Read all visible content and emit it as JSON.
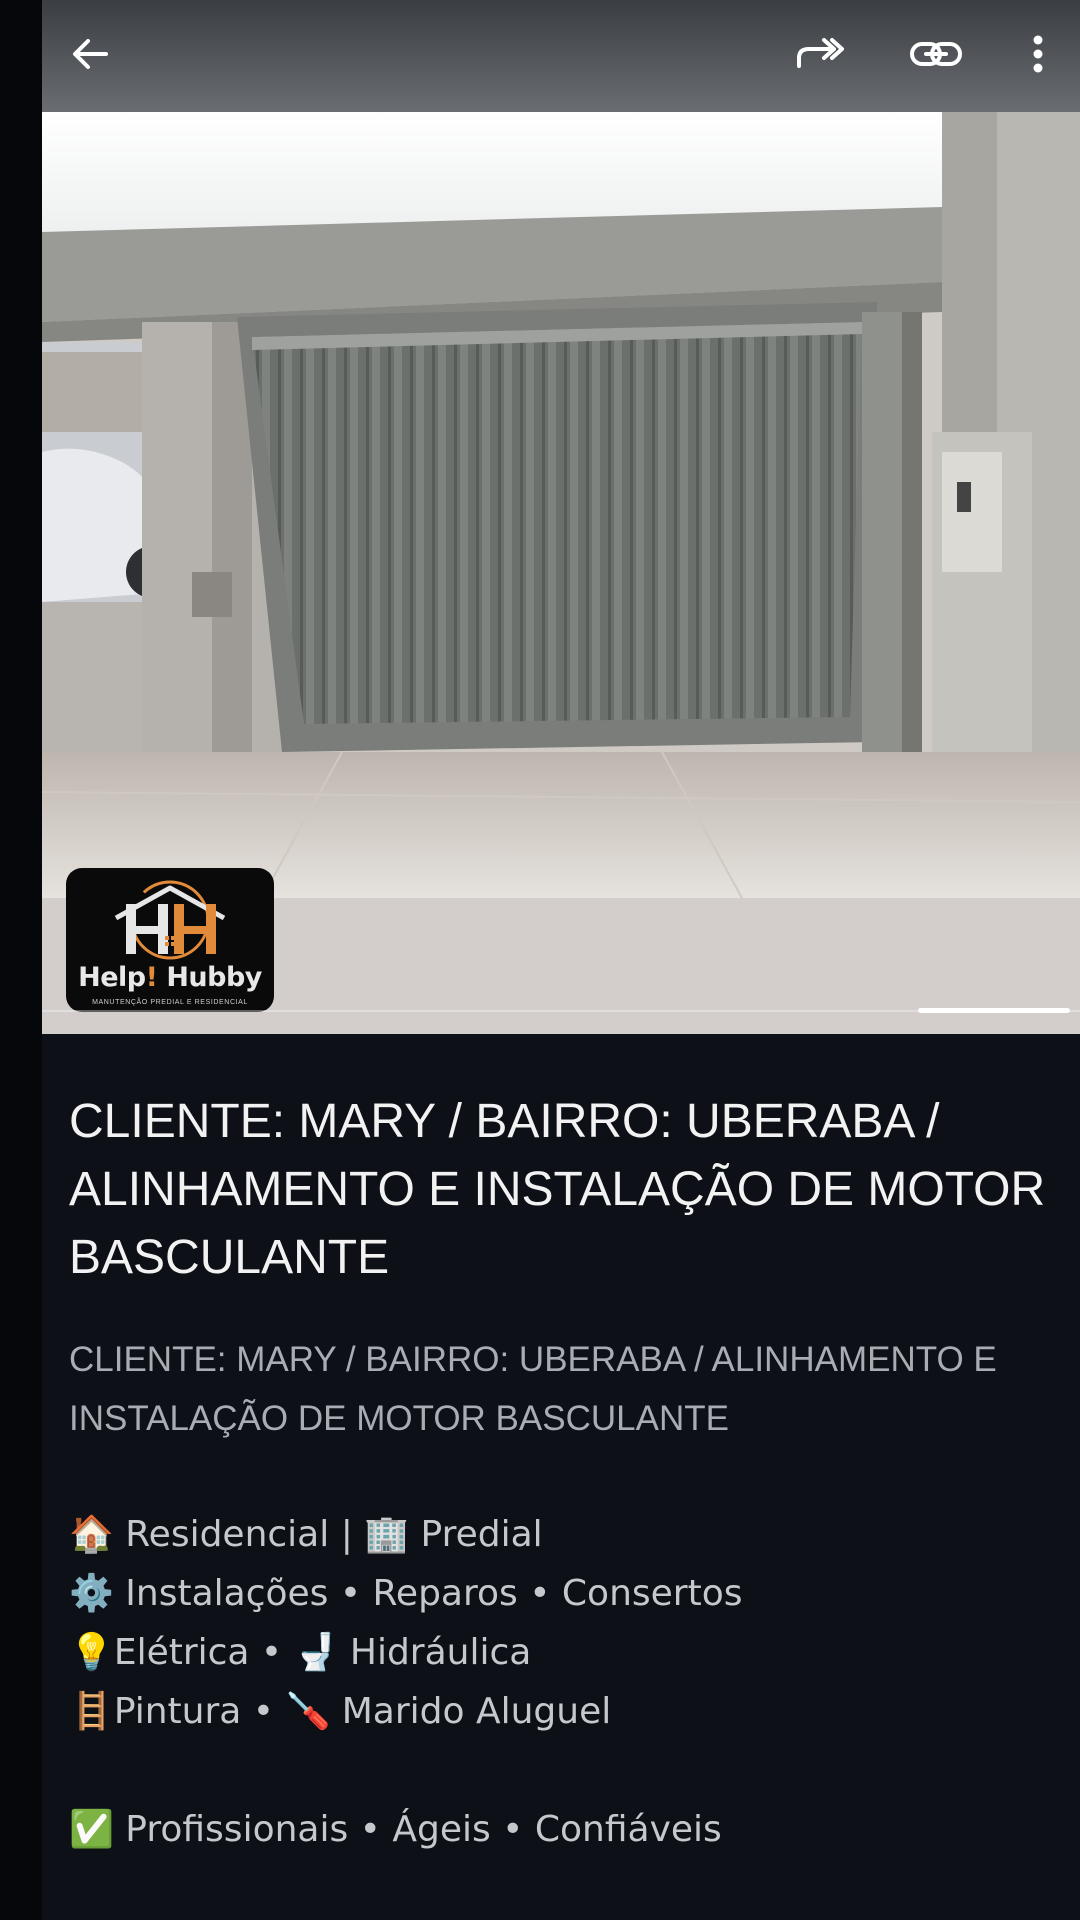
{
  "toolbar": {
    "back_icon": "arrow-left-icon",
    "forward_icon": "share-forward-icon",
    "link_icon": "link-icon",
    "more_icon": "more-vertical-icon"
  },
  "media": {
    "logo": {
      "word_left": "Help",
      "word_mark": "!",
      "word_right": " Hubby",
      "tagline": "MANUTENÇÃO PREDIAL E RESIDENCIAL"
    }
  },
  "post": {
    "title": "CLIENTE: MARY / BAIRRO: UBERABA / ALINHAMENTO E INSTALAÇÃO DE MOTOR BASCULANTE",
    "subtitle": "CLIENTE: MARY / BAIRRO: UBERABA / ALINHAMENTO E INSTALAÇÃO DE MOTOR BASCULANTE",
    "lines": [
      "🏠 Residencial | 🏢 Predial",
      "⚙️ Instalações • Reparos • Consertos",
      "💡Elétrica  • 🚽 Hidráulica",
      "🪜Pintura • 🪛 Marido Aluguel"
    ],
    "footer": "✅ Profissionais • Ágeis • Confiáveis"
  },
  "colors": {
    "background": "#0d1016",
    "toolbar_top": "#3a3d42",
    "title_text": "#f2f2f2",
    "body_text": "#c5c8cc",
    "logo_accent": "#e08a3a"
  }
}
